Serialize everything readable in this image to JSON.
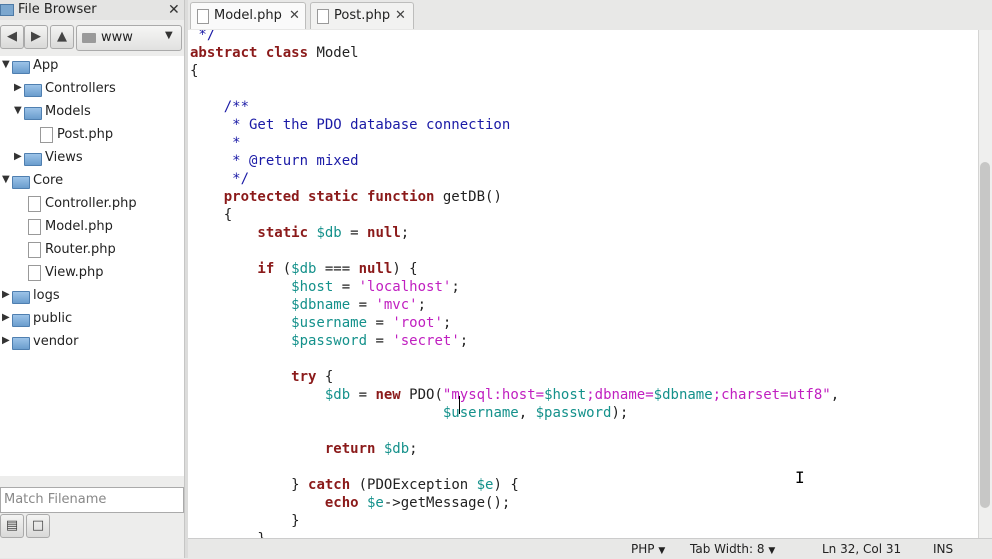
{
  "file_browser": {
    "title": "File Browser",
    "close": "✕",
    "location": "www",
    "filter_placeholder": "Match Filename",
    "tree": [
      {
        "label": "App",
        "type": "folder",
        "level": 0,
        "expanded": true
      },
      {
        "label": "Controllers",
        "type": "folder",
        "level": 1,
        "expanded": false
      },
      {
        "label": "Models",
        "type": "folder",
        "level": 1,
        "expanded": true
      },
      {
        "label": "Post.php",
        "type": "file",
        "level": 2
      },
      {
        "label": "Views",
        "type": "folder",
        "level": 1,
        "expanded": false
      },
      {
        "label": "Core",
        "type": "folder",
        "level": 0,
        "expanded": true
      },
      {
        "label": "Controller.php",
        "type": "file",
        "level": 1
      },
      {
        "label": "Model.php",
        "type": "file",
        "level": 1
      },
      {
        "label": "Router.php",
        "type": "file",
        "level": 1
      },
      {
        "label": "View.php",
        "type": "file",
        "level": 1
      },
      {
        "label": "logs",
        "type": "folder",
        "level": 0,
        "expanded": false
      },
      {
        "label": "public",
        "type": "folder",
        "level": 0,
        "expanded": false
      },
      {
        "label": "vendor",
        "type": "folder",
        "level": 0,
        "expanded": false
      }
    ]
  },
  "tabs": [
    {
      "label": "Model.php",
      "active": true,
      "close": "✕"
    },
    {
      "label": "Post.php",
      "active": false,
      "close": "✕"
    }
  ],
  "code_lines": [
    [
      [
        "cm",
        " */"
      ]
    ],
    [
      [
        "kw",
        "abstract class"
      ],
      [
        "pl",
        " Model"
      ]
    ],
    [
      [
        "pl",
        "{"
      ]
    ],
    [
      [
        "pl",
        ""
      ]
    ],
    [
      [
        "cm",
        "    /**"
      ]
    ],
    [
      [
        "cm",
        "     * Get the PDO database connection"
      ]
    ],
    [
      [
        "cm",
        "     *"
      ]
    ],
    [
      [
        "cm",
        "     * @return mixed"
      ]
    ],
    [
      [
        "cm",
        "     */"
      ]
    ],
    [
      [
        "kw",
        "    protected static function"
      ],
      [
        "pl",
        " getDB()"
      ]
    ],
    [
      [
        "pl",
        "    {"
      ]
    ],
    [
      [
        "kw",
        "        static"
      ],
      [
        "vr",
        " $db"
      ],
      [
        "pl",
        " = "
      ],
      [
        "kw",
        "null"
      ],
      [
        "pl",
        ";"
      ]
    ],
    [
      [
        "pl",
        ""
      ]
    ],
    [
      [
        "kw",
        "        if"
      ],
      [
        "pl",
        " ("
      ],
      [
        "vr",
        "$db"
      ],
      [
        "pl",
        " === "
      ],
      [
        "kw",
        "null"
      ],
      [
        "pl",
        ") {"
      ]
    ],
    [
      [
        "vr",
        "            $host"
      ],
      [
        "pl",
        " = "
      ],
      [
        "st",
        "'localhost'"
      ],
      [
        "pl",
        ";"
      ]
    ],
    [
      [
        "vr",
        "            $dbname"
      ],
      [
        "pl",
        " = "
      ],
      [
        "st",
        "'mvc'"
      ],
      [
        "pl",
        ";"
      ]
    ],
    [
      [
        "vr",
        "            $username"
      ],
      [
        "pl",
        " = "
      ],
      [
        "st",
        "'root'"
      ],
      [
        "pl",
        ";"
      ]
    ],
    [
      [
        "vr",
        "            $password"
      ],
      [
        "pl",
        " = "
      ],
      [
        "st",
        "'secret'"
      ],
      [
        "pl",
        ";"
      ]
    ],
    [
      [
        "pl",
        ""
      ]
    ],
    [
      [
        "kw",
        "            try"
      ],
      [
        "pl",
        " {"
      ]
    ],
    [
      [
        "vr",
        "                $db"
      ],
      [
        "pl",
        " = "
      ],
      [
        "kw",
        "new"
      ],
      [
        "pl",
        " PDO("
      ],
      [
        "st",
        "\"mysql:host="
      ],
      [
        "vr",
        "$host"
      ],
      [
        "st",
        ";dbname="
      ],
      [
        "vr",
        "$dbname"
      ],
      [
        "st",
        ";charset=utf8\""
      ],
      [
        "pl",
        ","
      ]
    ],
    [
      [
        "pl",
        "                              "
      ],
      [
        "vr",
        "$username"
      ],
      [
        "pl",
        ", "
      ],
      [
        "vr",
        "$password"
      ],
      [
        "pl",
        ");"
      ]
    ],
    [
      [
        "pl",
        ""
      ]
    ],
    [
      [
        "kw",
        "                return"
      ],
      [
        "vr",
        " $db"
      ],
      [
        "pl",
        ";"
      ]
    ],
    [
      [
        "pl",
        ""
      ]
    ],
    [
      [
        "pl",
        "            } "
      ],
      [
        "kw",
        "catch"
      ],
      [
        "pl",
        " (PDOException "
      ],
      [
        "vr",
        "$e"
      ],
      [
        "pl",
        ") {"
      ]
    ],
    [
      [
        "kw",
        "                echo"
      ],
      [
        "vr",
        " $e"
      ],
      [
        "pl",
        "->getMessage();"
      ]
    ],
    [
      [
        "pl",
        "            }"
      ]
    ],
    [
      [
        "pl",
        "        }"
      ]
    ]
  ],
  "status": {
    "language": "PHP",
    "tab_width": "Tab Width: 8",
    "position": "Ln 32, Col 31",
    "mode": "INS"
  },
  "colors": {
    "keyword": "#8b1a1a",
    "comment": "#1a1aa6",
    "variable": "#14918b",
    "string": "#c01fc0"
  }
}
